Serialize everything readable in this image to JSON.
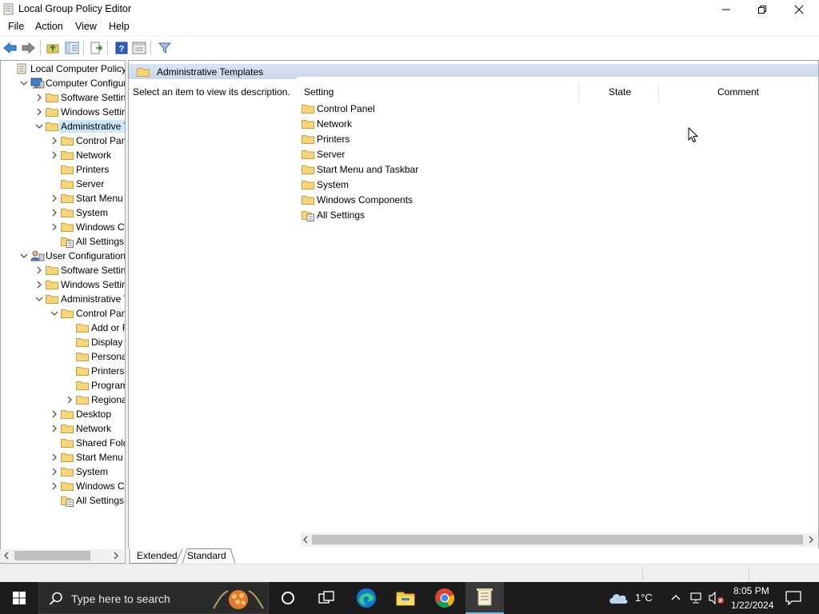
{
  "window": {
    "title": "Local Group Policy Editor"
  },
  "menu": [
    "File",
    "Action",
    "View",
    "Help"
  ],
  "tree": [
    {
      "label": "Local Computer Policy",
      "indent": 0,
      "arrow": "",
      "icon": "policy"
    },
    {
      "label": "Computer Configura",
      "indent": 1,
      "arrow": "down",
      "icon": "computer"
    },
    {
      "label": "Software Settings",
      "indent": 2,
      "arrow": "right",
      "icon": "folder"
    },
    {
      "label": "Windows Setting",
      "indent": 2,
      "arrow": "right",
      "icon": "folder"
    },
    {
      "label": "Administrative Te",
      "indent": 2,
      "arrow": "down",
      "icon": "folder",
      "selected": true
    },
    {
      "label": "Control Panel",
      "indent": 3,
      "arrow": "right",
      "icon": "folder"
    },
    {
      "label": "Network",
      "indent": 3,
      "arrow": "right",
      "icon": "folder"
    },
    {
      "label": "Printers",
      "indent": 3,
      "arrow": "",
      "icon": "folder"
    },
    {
      "label": "Server",
      "indent": 3,
      "arrow": "",
      "icon": "folder"
    },
    {
      "label": "Start Menu ar",
      "indent": 3,
      "arrow": "right",
      "icon": "folder"
    },
    {
      "label": "System",
      "indent": 3,
      "arrow": "right",
      "icon": "folder"
    },
    {
      "label": "Windows Cor",
      "indent": 3,
      "arrow": "right",
      "icon": "folder"
    },
    {
      "label": "All Settings",
      "indent": 3,
      "arrow": "",
      "icon": "settings"
    },
    {
      "label": "User Configuration",
      "indent": 1,
      "arrow": "down",
      "icon": "user"
    },
    {
      "label": "Software Settings",
      "indent": 2,
      "arrow": "right",
      "icon": "folder"
    },
    {
      "label": "Windows Setting",
      "indent": 2,
      "arrow": "right",
      "icon": "folder"
    },
    {
      "label": "Administrative Te",
      "indent": 2,
      "arrow": "down",
      "icon": "folder"
    },
    {
      "label": "Control Panel",
      "indent": 3,
      "arrow": "down",
      "icon": "folder"
    },
    {
      "label": "Add or Re",
      "indent": 4,
      "arrow": "",
      "icon": "folder"
    },
    {
      "label": "Display",
      "indent": 4,
      "arrow": "",
      "icon": "folder"
    },
    {
      "label": "Personaliz",
      "indent": 4,
      "arrow": "",
      "icon": "folder"
    },
    {
      "label": "Printers",
      "indent": 4,
      "arrow": "",
      "icon": "folder"
    },
    {
      "label": "Programs",
      "indent": 4,
      "arrow": "",
      "icon": "folder"
    },
    {
      "label": "Regional a",
      "indent": 4,
      "arrow": "right",
      "icon": "folder"
    },
    {
      "label": "Desktop",
      "indent": 3,
      "arrow": "right",
      "icon": "folder"
    },
    {
      "label": "Network",
      "indent": 3,
      "arrow": "right",
      "icon": "folder"
    },
    {
      "label": "Shared Folder",
      "indent": 3,
      "arrow": "",
      "icon": "folder"
    },
    {
      "label": "Start Menu ar",
      "indent": 3,
      "arrow": "right",
      "icon": "folder"
    },
    {
      "label": "System",
      "indent": 3,
      "arrow": "right",
      "icon": "folder"
    },
    {
      "label": "Windows Cor",
      "indent": 3,
      "arrow": "right",
      "icon": "folder"
    },
    {
      "label": "All Settings",
      "indent": 3,
      "arrow": "",
      "icon": "settings"
    }
  ],
  "right": {
    "header": "Administrative Templates",
    "description": "Select an item to view its description.",
    "columns": [
      "Setting",
      "State",
      "Comment"
    ],
    "items": [
      {
        "label": "Control Panel",
        "icon": "folder"
      },
      {
        "label": "Network",
        "icon": "folder"
      },
      {
        "label": "Printers",
        "icon": "folder"
      },
      {
        "label": "Server",
        "icon": "folder"
      },
      {
        "label": "Start Menu and Taskbar",
        "icon": "folder"
      },
      {
        "label": "System",
        "icon": "folder"
      },
      {
        "label": "Windows Components",
        "icon": "folder"
      },
      {
        "label": "All Settings",
        "icon": "settings"
      }
    ]
  },
  "tabs": {
    "extended": "Extended",
    "standard": "Standard"
  },
  "taskbar": {
    "search_placeholder": "Type here to search",
    "weather": "1°C",
    "time": "8:05 PM",
    "date": "1/22/2024"
  }
}
